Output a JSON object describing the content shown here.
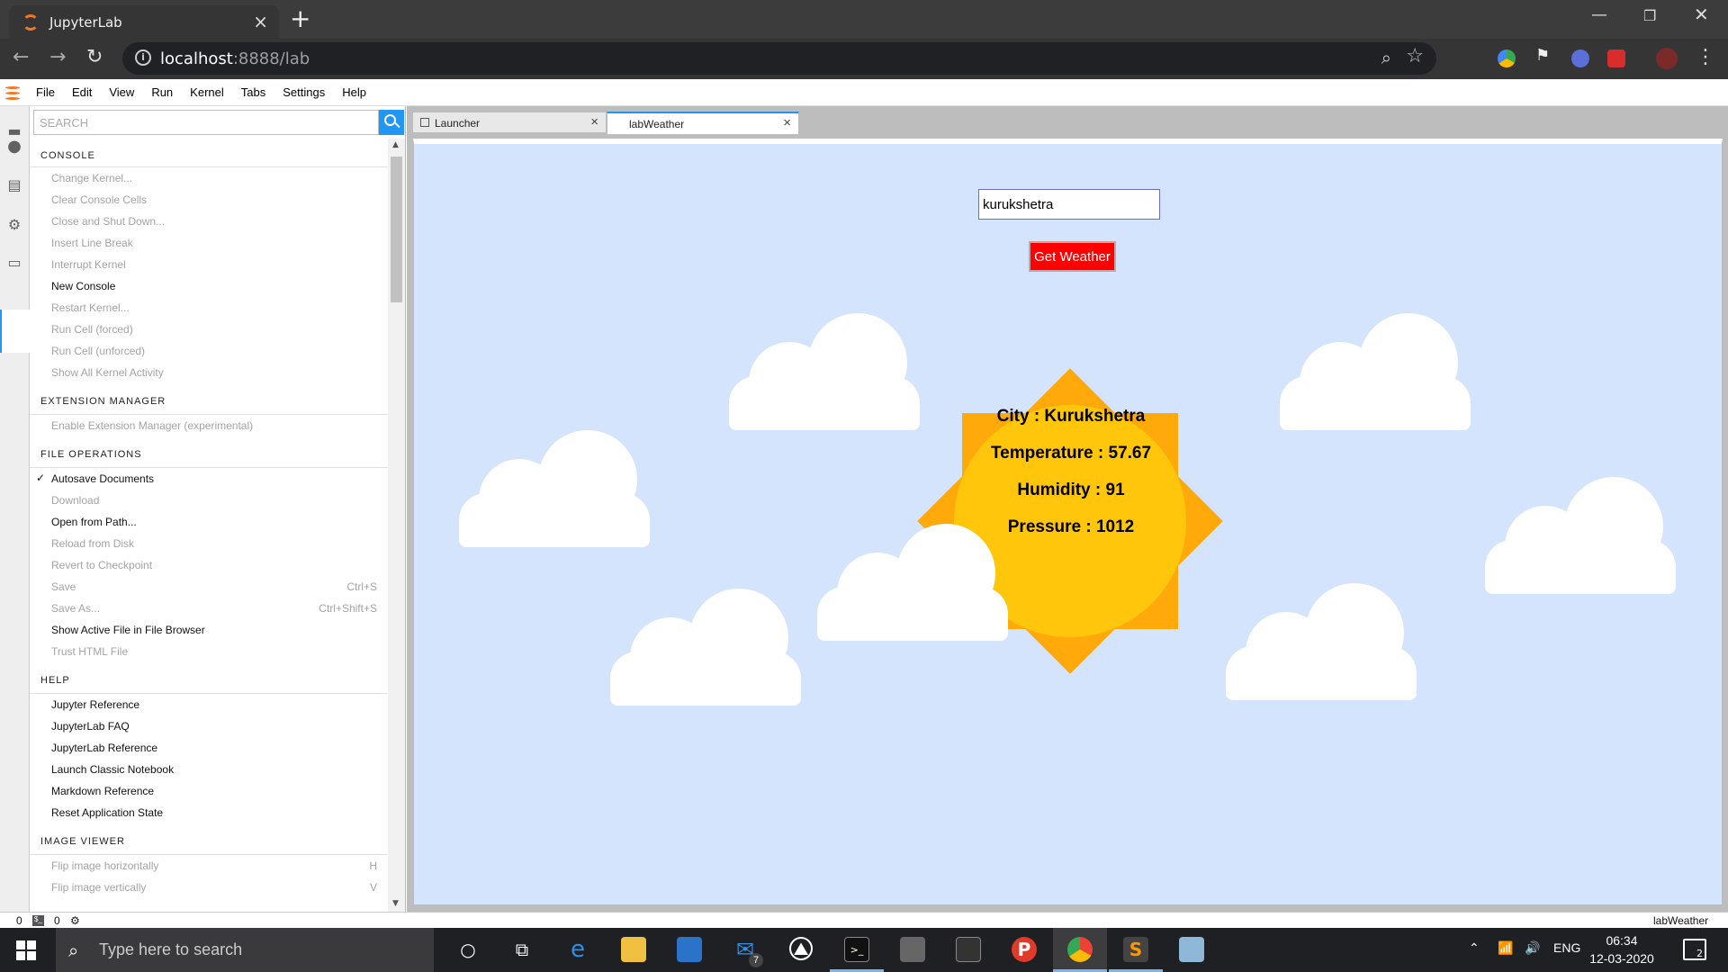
{
  "browser": {
    "tab_title": "JupyterLab",
    "url_host": "localhost",
    "url_rest": ":8888/lab"
  },
  "menubar": [
    "File",
    "Edit",
    "View",
    "Run",
    "Kernel",
    "Tabs",
    "Settings",
    "Help"
  ],
  "palette": {
    "search_placeholder": "SEARCH",
    "categories": [
      {
        "title": "CONSOLE",
        "items": [
          {
            "label": "Change Kernel...",
            "enabled": false
          },
          {
            "label": "Clear Console Cells",
            "enabled": false
          },
          {
            "label": "Close and Shut Down...",
            "enabled": false
          },
          {
            "label": "Insert Line Break",
            "enabled": false
          },
          {
            "label": "Interrupt Kernel",
            "enabled": false
          },
          {
            "label": "New Console",
            "enabled": true
          },
          {
            "label": "Restart Kernel...",
            "enabled": false
          },
          {
            "label": "Run Cell (forced)",
            "enabled": false
          },
          {
            "label": "Run Cell (unforced)",
            "enabled": false
          },
          {
            "label": "Show All Kernel Activity",
            "enabled": false
          }
        ]
      },
      {
        "title": "EXTENSION MANAGER",
        "items": [
          {
            "label": "Enable Extension Manager (experimental)",
            "enabled": false
          }
        ]
      },
      {
        "title": "FILE OPERATIONS",
        "items": [
          {
            "label": "Autosave Documents",
            "enabled": true,
            "checked": true
          },
          {
            "label": "Download",
            "enabled": false
          },
          {
            "label": "Open from Path...",
            "enabled": true
          },
          {
            "label": "Reload from Disk",
            "enabled": false
          },
          {
            "label": "Revert to Checkpoint",
            "enabled": false
          },
          {
            "label": "Save",
            "enabled": false,
            "shortcut": "Ctrl+S"
          },
          {
            "label": "Save As...",
            "enabled": false,
            "shortcut": "Ctrl+Shift+S"
          },
          {
            "label": "Show Active File in File Browser",
            "enabled": true
          },
          {
            "label": "Trust HTML File",
            "enabled": false
          }
        ]
      },
      {
        "title": "HELP",
        "items": [
          {
            "label": "Jupyter Reference",
            "enabled": true
          },
          {
            "label": "JupyterLab FAQ",
            "enabled": true
          },
          {
            "label": "JupyterLab Reference",
            "enabled": true
          },
          {
            "label": "Launch Classic Notebook",
            "enabled": true
          },
          {
            "label": "Markdown Reference",
            "enabled": true
          },
          {
            "label": "Reset Application State",
            "enabled": true
          }
        ]
      },
      {
        "title": "IMAGE VIEWER",
        "items": [
          {
            "label": "Flip image horizontally",
            "enabled": false,
            "shortcut": "H"
          },
          {
            "label": "Flip image vertically",
            "enabled": false,
            "shortcut": "V"
          }
        ]
      }
    ]
  },
  "doc_tabs": [
    {
      "label": "Launcher",
      "active": false
    },
    {
      "label": "labWeather",
      "active": true
    }
  ],
  "weather": {
    "city_value": "kurukshetra",
    "button_label": "Get Weather",
    "city_line": "City : Kurukshetra",
    "temperature_line": "Temperature : 57.67",
    "humidity_line": "Humidity : 91",
    "pressure_line": "Pressure : 1012"
  },
  "status": {
    "terminals": "0",
    "kernels": "0",
    "active_doc": "labWeather"
  },
  "taskbar": {
    "search_placeholder": "Type here to search",
    "mail_badge": "7",
    "language": "ENG",
    "time": "06:34",
    "date": "12-03-2020",
    "notifications": "2"
  },
  "colors": {
    "accent": "#2196f3",
    "panel_bg": "#d4e4fc",
    "button_bg": "#ff0000",
    "sun_core": "#ffc60b",
    "sun_rays": "#ffa90a"
  }
}
